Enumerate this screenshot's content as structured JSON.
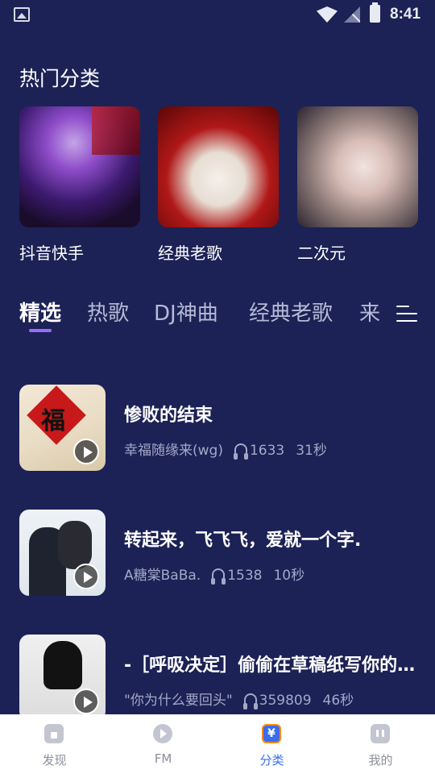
{
  "status_bar": {
    "time": "8:41"
  },
  "hot_categories": {
    "title": "热门分类",
    "items": [
      {
        "label": "抖音快手"
      },
      {
        "label": "经典老歌"
      },
      {
        "label": "二次元"
      }
    ]
  },
  "tabs": [
    "精选",
    "热歌",
    "DJ神曲",
    "经典老歌",
    "来"
  ],
  "active_tab": 0,
  "songs": [
    {
      "title": "惨败的结束",
      "artist": "幸福随缘来(wg)",
      "plays": "1633",
      "duration": "31秒"
    },
    {
      "title": "转起来，飞飞飞，爱就一个字.",
      "artist": "A糖棠BaBa.",
      "plays": "1538",
      "duration": "10秒"
    },
    {
      "title": "-［呼吸决定］偷偷在草稿纸写你的名字-",
      "artist": "\"你为什么要回头\"",
      "plays": "359809",
      "duration": "46秒"
    }
  ],
  "cover_text": {
    "song1_badge": "福"
  },
  "bottom_nav": [
    {
      "label": "发现",
      "icon": "discover-icon"
    },
    {
      "label": "FM",
      "icon": "fm-play-icon"
    },
    {
      "label": "分类",
      "icon": "category-icon",
      "badge": "¥"
    },
    {
      "label": "我的",
      "icon": "profile-icon"
    }
  ],
  "active_nav": 2,
  "colors": {
    "background": "#1c2255",
    "accent": "#3a6cf0",
    "tab_indicator": "#9a6bff"
  }
}
